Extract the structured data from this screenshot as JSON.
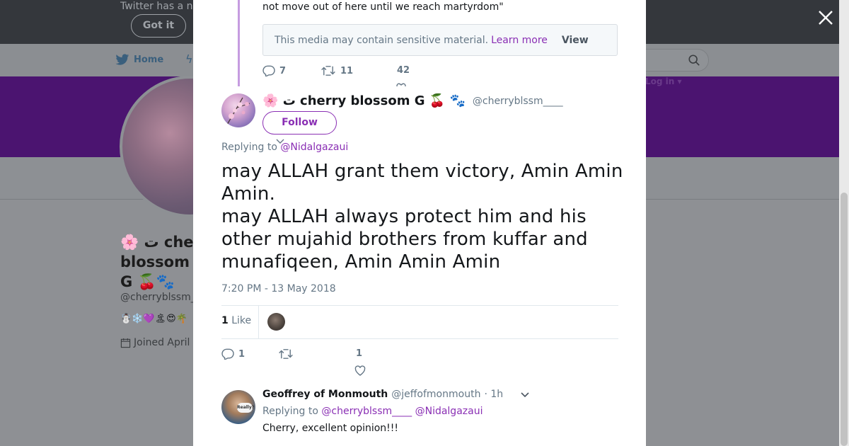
{
  "background": {
    "banner_text": "Twitter has a n",
    "got_it": "Got it",
    "nav_home": "Home",
    "login": "Log in ▾",
    "profile_name": "🌸 ت che blossom G 🍒🐾",
    "profile_handle": "@cherryblssm_",
    "profile_emojis": "☃️❄️💜🏝😍🌴",
    "joined": "Joined April"
  },
  "parent_tweet": {
    "text": "not move out of here until we reach martyrdom\"",
    "media_notice": "This media may contain sensitive material.",
    "learn_more": "Learn more",
    "view": "View",
    "replies": "7",
    "retweets": "11",
    "likes": "42"
  },
  "main_tweet": {
    "display_name": "🌸 ت cherry blossom G 🍒 🐾",
    "handle": "@cherryblssm____",
    "follow": "Follow",
    "replying_to_label": "Replying to",
    "replying_to_user": "@Nidalgazaui",
    "text_line1": "may ALLAH grant them victory, Amin Amin Amin.",
    "text_line2": "may ALLAH always protect him and his other mujahid brothers from kuffar and munafiqeen, Amin Amin Amin",
    "timestamp": "7:20 PM - 13 May 2018",
    "like_count": "1",
    "like_label": "Like",
    "replies": "1",
    "likes": "1"
  },
  "reply_tweet": {
    "name": "Geoffrey of Monmouth",
    "handle": "@jeffofmonmouth",
    "time": "· 1h",
    "replying_to_label": "Replying to",
    "replying_to_user1": "@cherryblssm____",
    "replying_to_user2": "@Nidalgazaui",
    "text": "Cherry, excellent opinion!!!",
    "avatar_badge": "Really?"
  },
  "colors": {
    "accent": "#8a2fb4",
    "cover": "#4b1470",
    "twitter_blue": "#1da1f2"
  }
}
